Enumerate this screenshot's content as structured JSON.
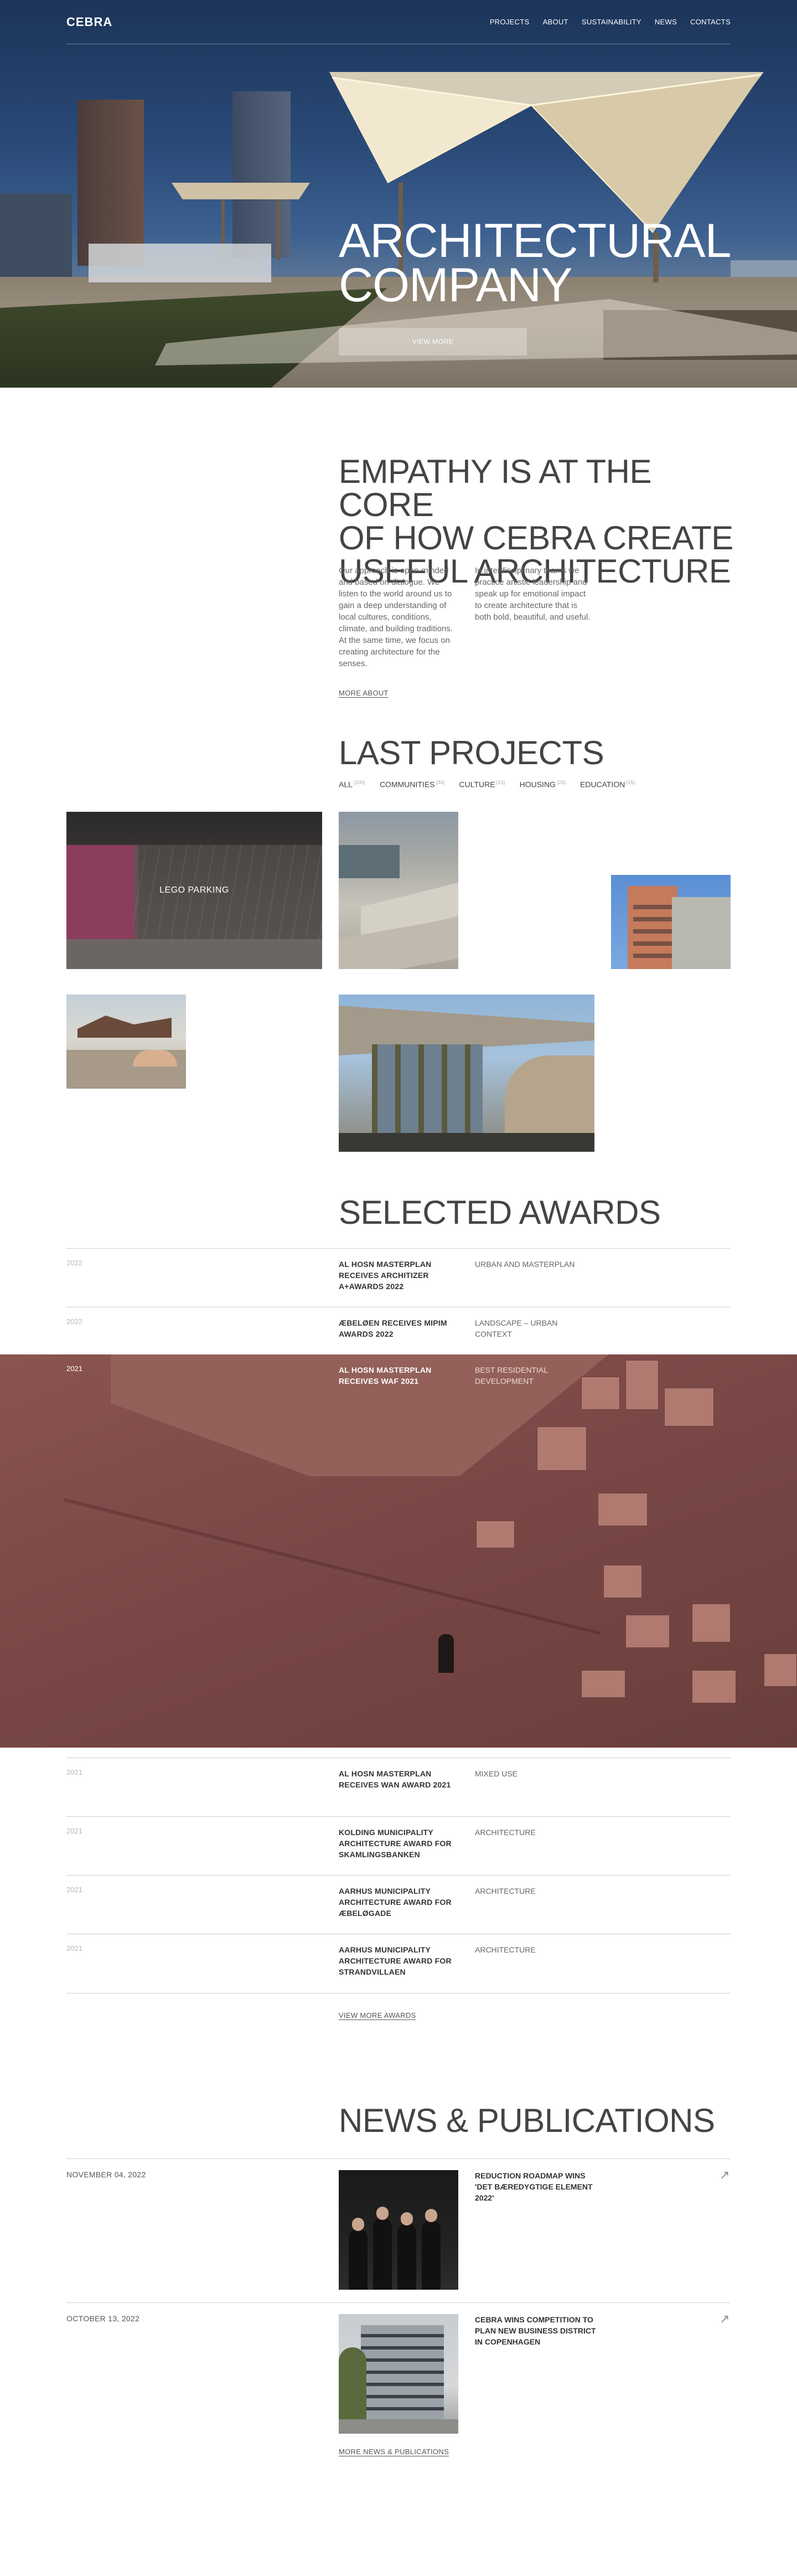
{
  "brand": {
    "logo": "CEBRA",
    "accent": "#ffffff",
    "text_color": "#3a3a3a"
  },
  "nav": {
    "items": [
      {
        "label": "PROJECTS"
      },
      {
        "label": "ABOUT"
      },
      {
        "label": "SUSTAINABILITY"
      },
      {
        "label": "NEWS"
      },
      {
        "label": "CONTACTS"
      }
    ]
  },
  "hero": {
    "title_line1": "ARCHITECTURAL",
    "title_line2": "COMPANY",
    "button_label": "VIEW MORE"
  },
  "about": {
    "heading_line1": "EMPATHY IS AT THE CORE",
    "heading_line2": "OF HOW CEBRA CREATE",
    "heading_line3": "USEFUL  ARCHITECTURE",
    "paragraph_left": "Our approach is open-minded and based on dialogue. We listen to the world around us to gain a deep understanding of local cultures, conditions, climate, and building traditions. At the same time, we focus on creating architecture for the senses.",
    "paragraph_right": "In interdisciplinary teams we practice artistic leadership and speak up for emotional impact to create architecture that is both bold, beautiful, and useful.",
    "more_link": "MORE ABOUT"
  },
  "projects": {
    "heading": "LAST PROJECTS",
    "filters": [
      {
        "label": "ALL",
        "count": "(200)"
      },
      {
        "label": "COMMUNITIES",
        "count": "(34)"
      },
      {
        "label": "CULTURE",
        "count": "(23)"
      },
      {
        "label": "HOUSING",
        "count": "(23)"
      },
      {
        "label": "EDUCATION",
        "count": "(26)"
      }
    ],
    "featured_label": "LEGO PARKING"
  },
  "awards": {
    "heading": "SELECTED AWARDS",
    "rows": [
      {
        "year": "2022",
        "title": "AL HOSN MASTERPLAN RECEIVES ARCHITIZER A+AWARDS 2022",
        "category": "URBAN AND MASTERPLAN"
      },
      {
        "year": "2022",
        "title": "ÆBELØEN RECEIVES MIPIM AWARDS 2022",
        "category": "LANDSCAPE – URBAN CONTEXT"
      },
      {
        "year": "2021",
        "title": "AL HOSN MASTERPLAN RECEIVES WAF 2021",
        "category": "BEST RESIDENTIAL DEVELOPMENT"
      },
      {
        "year": "2021",
        "title": "AL HOSN MASTERPLAN RECEIVES WAN AWARD 2021",
        "category": "MIXED USE"
      },
      {
        "year": "2021",
        "title": "KOLDING MUNICIPALITY ARCHITECTURE AWARD FOR SKAMLINGSBANKEN",
        "category": "ARCHITECTURE"
      },
      {
        "year": "2021",
        "title": "AARHUS MUNICIPALITY ARCHITECTURE AWARD FOR ÆBELØGADE",
        "category": "ARCHITECTURE"
      },
      {
        "year": "2021",
        "title": "AARHUS MUNICIPALITY ARCHITECTURE AWARD FOR STRANDVILLAEN",
        "category": "ARCHITECTURE"
      }
    ],
    "more_link": "VIEW MORE AWARDS"
  },
  "news": {
    "heading": "NEWS & PUBLICATIONS",
    "items": [
      {
        "date": "NOVEMBER 04, 2022",
        "title": "REDUCTION ROADMAP WINS 'DET BÆREDYGTIGE ELEMENT 2022'",
        "arrow": "↗"
      },
      {
        "date": "OCTOBER 13, 2022",
        "title": "CEBRA WINS COMPETITION TO PLAN NEW BUSINESS DISTRICT IN COPENHAGEN",
        "arrow": "↗"
      }
    ],
    "more_link": "MORE NEWS & PUBLICATIONS"
  }
}
